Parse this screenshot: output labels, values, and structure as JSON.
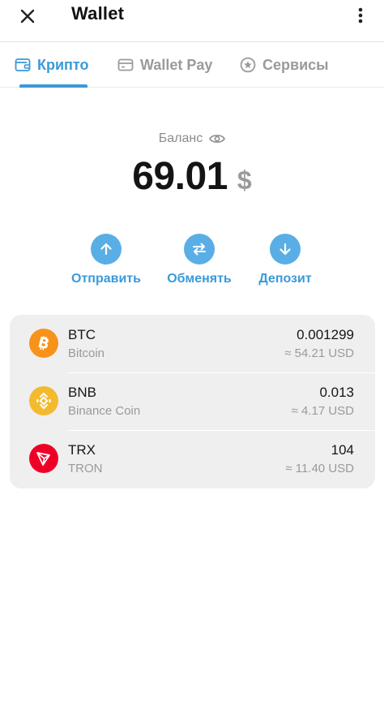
{
  "header": {
    "title": "Wallet",
    "close_icon": "close-icon",
    "menu_icon": "more-vertical-icon"
  },
  "tabs": [
    {
      "label": "Крипто",
      "icon": "wallet-icon",
      "active": true
    },
    {
      "label": "Wallet Pay",
      "icon": "card-icon",
      "active": false
    },
    {
      "label": "Сервисы",
      "icon": "star-circle-icon",
      "active": false
    }
  ],
  "balance": {
    "label": "Баланс",
    "value": "69.01",
    "currency": "$",
    "visibility_icon": "eye-icon"
  },
  "actions": [
    {
      "label": "Отправить",
      "icon": "arrow-up-icon"
    },
    {
      "label": "Обменять",
      "icon": "swap-icon"
    },
    {
      "label": "Депозит",
      "icon": "arrow-down-icon"
    }
  ],
  "assets": [
    {
      "symbol": "BTC",
      "name": "Bitcoin",
      "amount": "0.001299",
      "usd": "≈ 54.21 USD",
      "color": "#f7931a"
    },
    {
      "symbol": "BNB",
      "name": "Binance Coin",
      "amount": "0.013",
      "usd": "≈ 4.17 USD",
      "color": "#f3ba2f"
    },
    {
      "symbol": "TRX",
      "name": "TRON",
      "amount": "104",
      "usd": "≈ 11.40 USD",
      "color": "#ef0027"
    }
  ],
  "colors": {
    "accent": "#3a9ad9",
    "accent_button": "#5aaee6",
    "muted_text": "#9a9a9a",
    "card_bg": "#efefef"
  }
}
